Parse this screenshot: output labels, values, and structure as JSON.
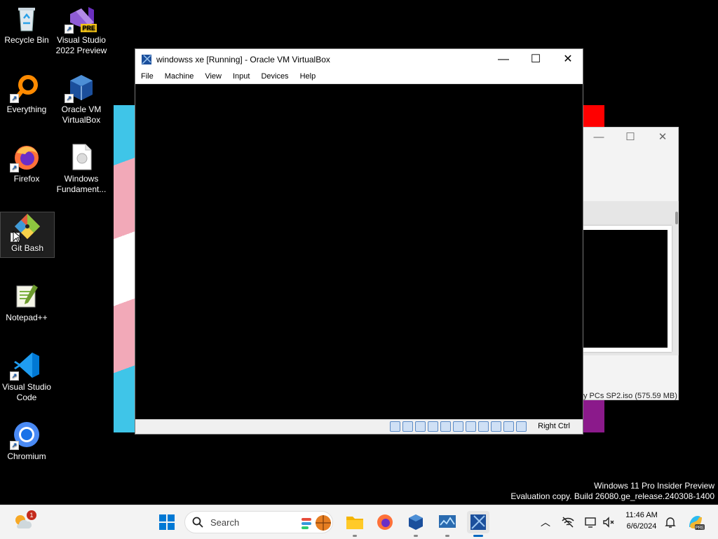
{
  "desktop": {
    "icons": [
      {
        "label": "Recycle Bin",
        "icon": "recycle-bin-icon"
      },
      {
        "label": "Visual Studio 2022 Preview",
        "icon": "visual-studio-icon",
        "badge": "PRE"
      },
      {
        "label": "Everything",
        "icon": "everything-search-icon"
      },
      {
        "label": "Oracle VM VirtualBox",
        "icon": "virtualbox-icon"
      },
      {
        "label": "Firefox",
        "icon": "firefox-icon"
      },
      {
        "label": "Windows Fundament...",
        "icon": "document-icon"
      },
      {
        "label": "Git Bash",
        "icon": "git-bash-icon"
      },
      {
        "label": "Notepad++",
        "icon": "notepadpp-icon"
      },
      {
        "label": "Visual Studio Code",
        "icon": "vscode-icon"
      },
      {
        "label": "Chromium",
        "icon": "chromium-icon"
      }
    ]
  },
  "vbox": {
    "title": "windowss xe [Running] - Oracle VM VirtualBox",
    "menu": [
      "File",
      "Machine",
      "View",
      "Input",
      "Devices",
      "Help"
    ],
    "host_key": "Right Ctrl"
  },
  "bg_window": {
    "iso_text": "y PCs SP2.iso (575.59 MB)"
  },
  "watermark": {
    "line1": "Windows 11 Pro Insider Preview",
    "line2": "Evaluation copy. Build 26080.ge_release.240308-1400"
  },
  "taskbar": {
    "search_label": "Search",
    "time": "11:46 AM",
    "date": "6/6/2024",
    "weather_badge": "1"
  },
  "colors": {
    "desktop": "#000000",
    "taskbar": "#f3f3f3",
    "accent": "#0067c0"
  }
}
